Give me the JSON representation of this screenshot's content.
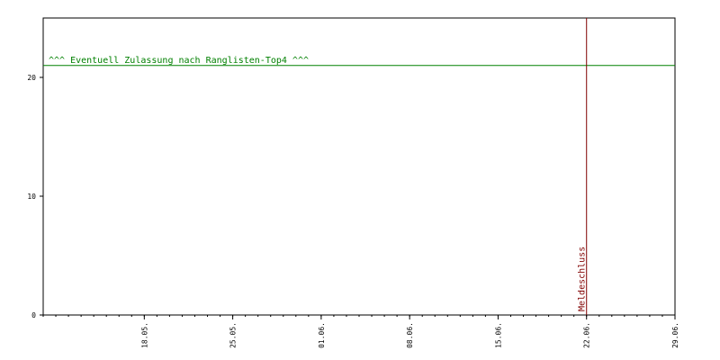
{
  "chart_data": {
    "type": "line",
    "title": "",
    "xlabel": "",
    "ylabel": "",
    "ylim": [
      0,
      25
    ],
    "xlim": [
      "2024-05-10",
      "2024-06-29"
    ],
    "y_ticks": [
      0,
      10,
      20
    ],
    "x_ticks": [
      {
        "date": "2024-05-18",
        "label": "18.05."
      },
      {
        "date": "2024-05-25",
        "label": "25.05."
      },
      {
        "date": "2024-06-01",
        "label": "01.06."
      },
      {
        "date": "2024-06-08",
        "label": "08.06."
      },
      {
        "date": "2024-06-15",
        "label": "15.06."
      },
      {
        "date": "2024-06-22",
        "label": "22.06."
      },
      {
        "date": "2024-06-29",
        "label": "29.06."
      }
    ],
    "grid": false,
    "series": [],
    "annotations": {
      "hline": {
        "y": 21,
        "label": "^^^ Eventuell Zulassung nach Ranglisten-Top4 ^^^",
        "color": "#008000"
      },
      "vline": {
        "date": "2024-06-22",
        "label": "Meldeschluss",
        "color": "#800000"
      }
    }
  }
}
